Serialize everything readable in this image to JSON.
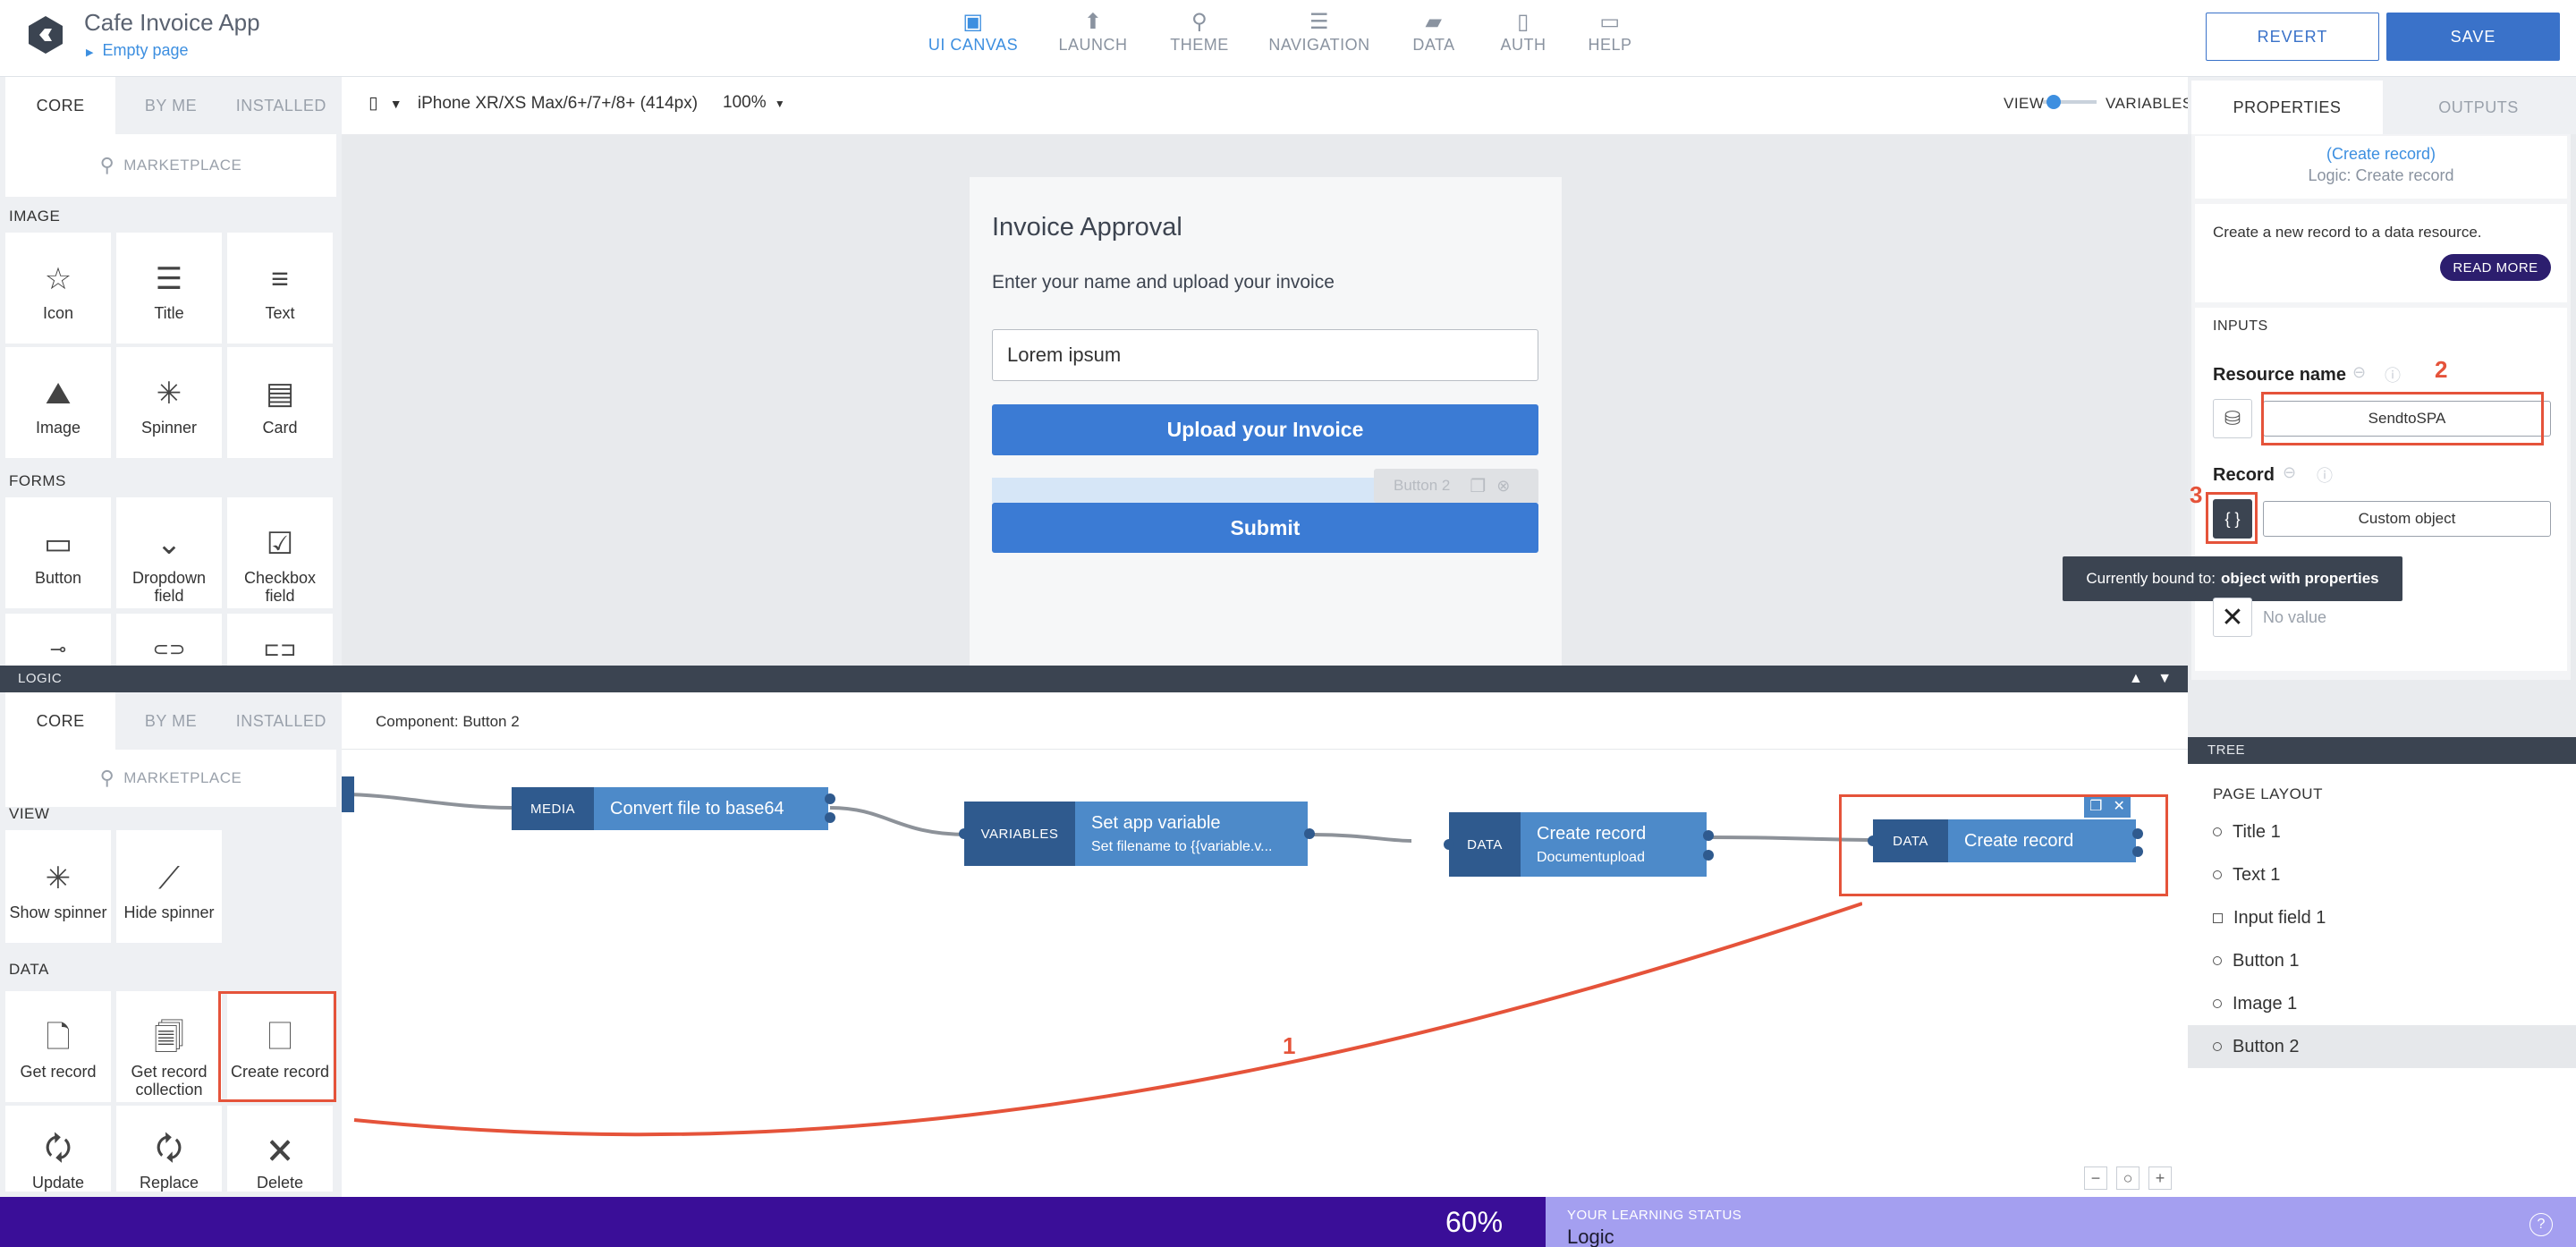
{
  "header": {
    "app_title": "Cafe Invoice App",
    "page_name": "Empty page",
    "nav": [
      {
        "label": "UI CANVAS",
        "icon": "canvas-icon"
      },
      {
        "label": "LAUNCH",
        "icon": "launch-icon"
      },
      {
        "label": "THEME",
        "icon": "theme-icon"
      },
      {
        "label": "NAVIGATION",
        "icon": "navigation-icon"
      },
      {
        "label": "DATA",
        "icon": "data-icon"
      },
      {
        "label": "AUTH",
        "icon": "auth-icon"
      },
      {
        "label": "HELP",
        "icon": "help-icon"
      }
    ],
    "revert": "REVERT",
    "save": "SAVE"
  },
  "components": {
    "tabs": [
      "CORE",
      "BY ME",
      "INSTALLED"
    ],
    "marketplace": "MARKETPLACE",
    "sections": [
      {
        "label": "IMAGE",
        "items": [
          "Icon",
          "Title",
          "Text",
          "Image",
          "Spinner",
          "Card"
        ]
      },
      {
        "label": "FORMS",
        "items": [
          "Button",
          "Dropdown field",
          "Checkbox field"
        ]
      }
    ]
  },
  "canvas": {
    "device": "iPhone XR/XS Max/6+/7+/8+ (414px)",
    "zoom": "100%",
    "view": "VIEW",
    "variables": "VARIABLES",
    "phone": {
      "title": "Invoice Approval",
      "subtitle": "Enter your name and upload your invoice",
      "input_value": "Lorem ipsum",
      "upload_label": "Upload your Invoice",
      "selected_tag": "Button 2",
      "submit_label": "Submit"
    }
  },
  "logic": {
    "bar_label": "LOGIC",
    "tabs": [
      "CORE",
      "BY ME",
      "INSTALLED"
    ],
    "marketplace": "MARKETPLACE",
    "component": "Component: Button 2",
    "sections": [
      {
        "label": "VIEW",
        "items": [
          "Show spinner",
          "Hide spinner"
        ]
      },
      {
        "label": "DATA",
        "items": [
          "Get record",
          "Get record collection",
          "Create record",
          "Update",
          "Replace",
          "Delete"
        ]
      }
    ],
    "nodes": [
      {
        "type": "MEDIA",
        "title": "Convert file to base64",
        "sub": ""
      },
      {
        "type": "VARIABLES",
        "title": "Set app variable",
        "sub": "Set filename to {{variable.v..."
      },
      {
        "type": "DATA",
        "title": "Create record",
        "sub": "Documentupload"
      },
      {
        "type": "DATA",
        "title": "Create record",
        "sub": ""
      }
    ]
  },
  "properties": {
    "tabs": [
      "PROPERTIES",
      "OUTPUTS"
    ],
    "node_name": "(Create record)",
    "node_kind": "Logic: Create record",
    "description": "Create a new record to a data resource.",
    "read_more": "READ MORE",
    "inputs_label": "INPUTS",
    "resource_label": "Resource name",
    "resource_value": "SendtoSPA",
    "record_label": "Record",
    "record_value": "Custom object",
    "tooltip_prefix": "Currently bound to:",
    "tooltip_bold": "object with properties",
    "no_value": "No value"
  },
  "tree": {
    "bar": "TREE",
    "title": "PAGE LAYOUT",
    "items": [
      "Title 1",
      "Text 1",
      "Input field 1",
      "Button 1",
      "Image 1",
      "Button 2"
    ]
  },
  "status": {
    "percent": "60%",
    "caption": "YOUR LEARNING STATUS",
    "value": "Logic"
  },
  "annotations": [
    "1",
    "2",
    "3"
  ],
  "colors": {
    "accent": "#3d8fe0",
    "primary_button": "#3a72c9",
    "annotation": "#e5533a",
    "status_bar": "#3a0e98"
  }
}
